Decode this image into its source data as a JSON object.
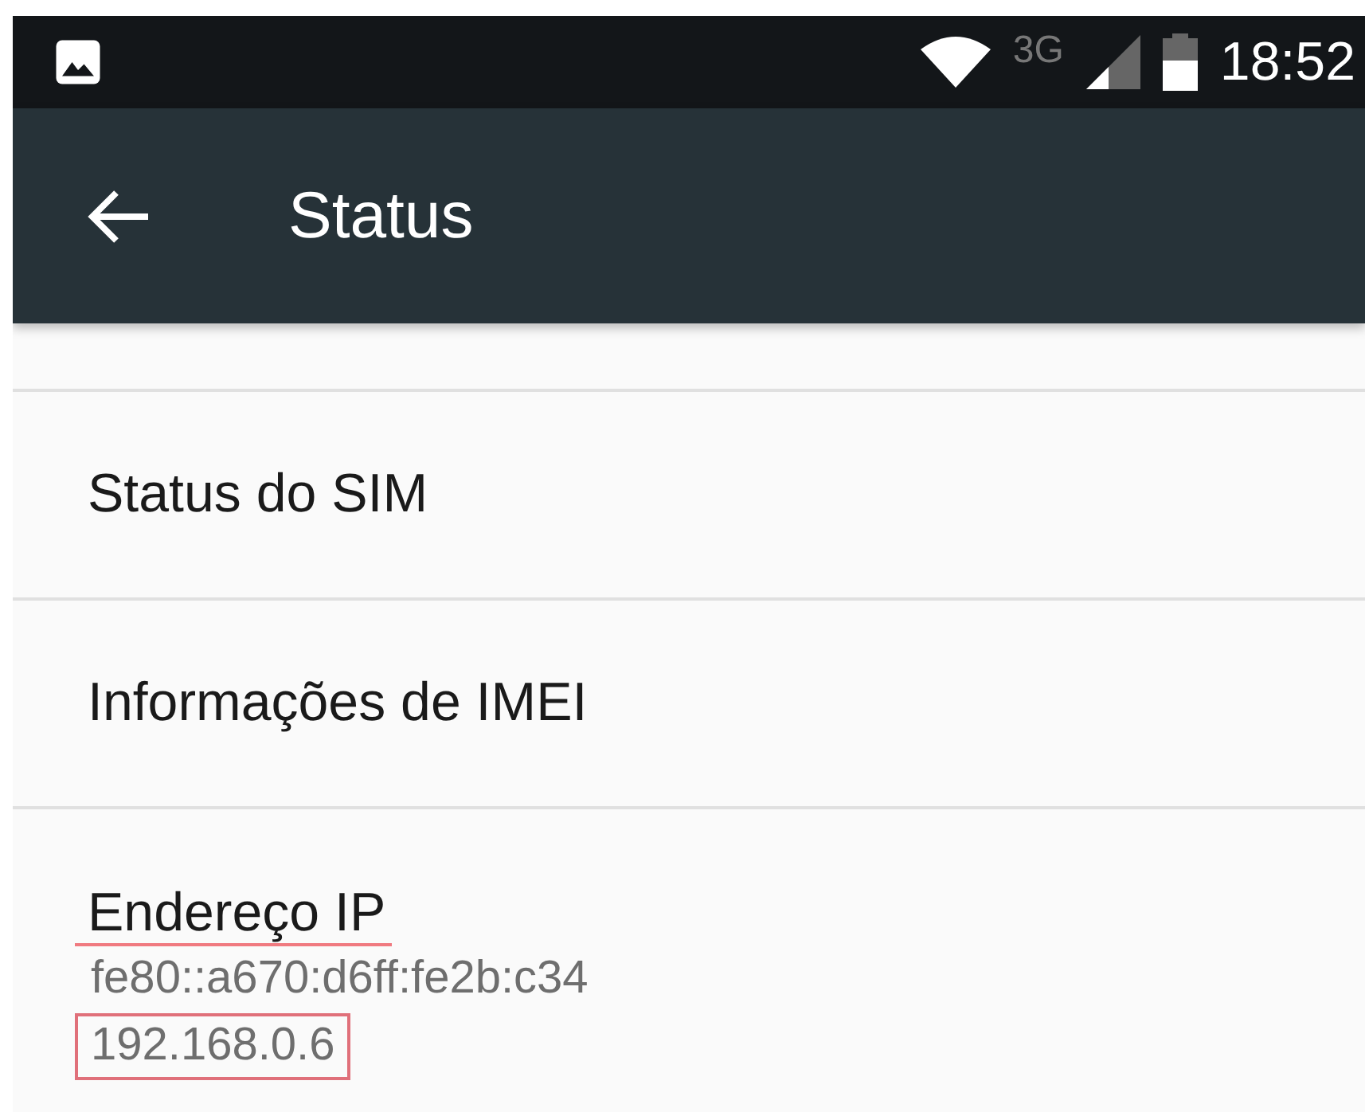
{
  "status_bar": {
    "network": "3G",
    "time": "18:52"
  },
  "app_bar": {
    "title": "Status"
  },
  "items": [
    {
      "title": "Status do SIM"
    },
    {
      "title": "Informações de IMEI"
    },
    {
      "title": "Endereço IP",
      "underlined": true,
      "lines": [
        {
          "text": "fe80::a670:d6ff:fe2b:c34",
          "boxed": false
        },
        {
          "text": "192.168.0.6",
          "boxed": true
        }
      ]
    }
  ]
}
